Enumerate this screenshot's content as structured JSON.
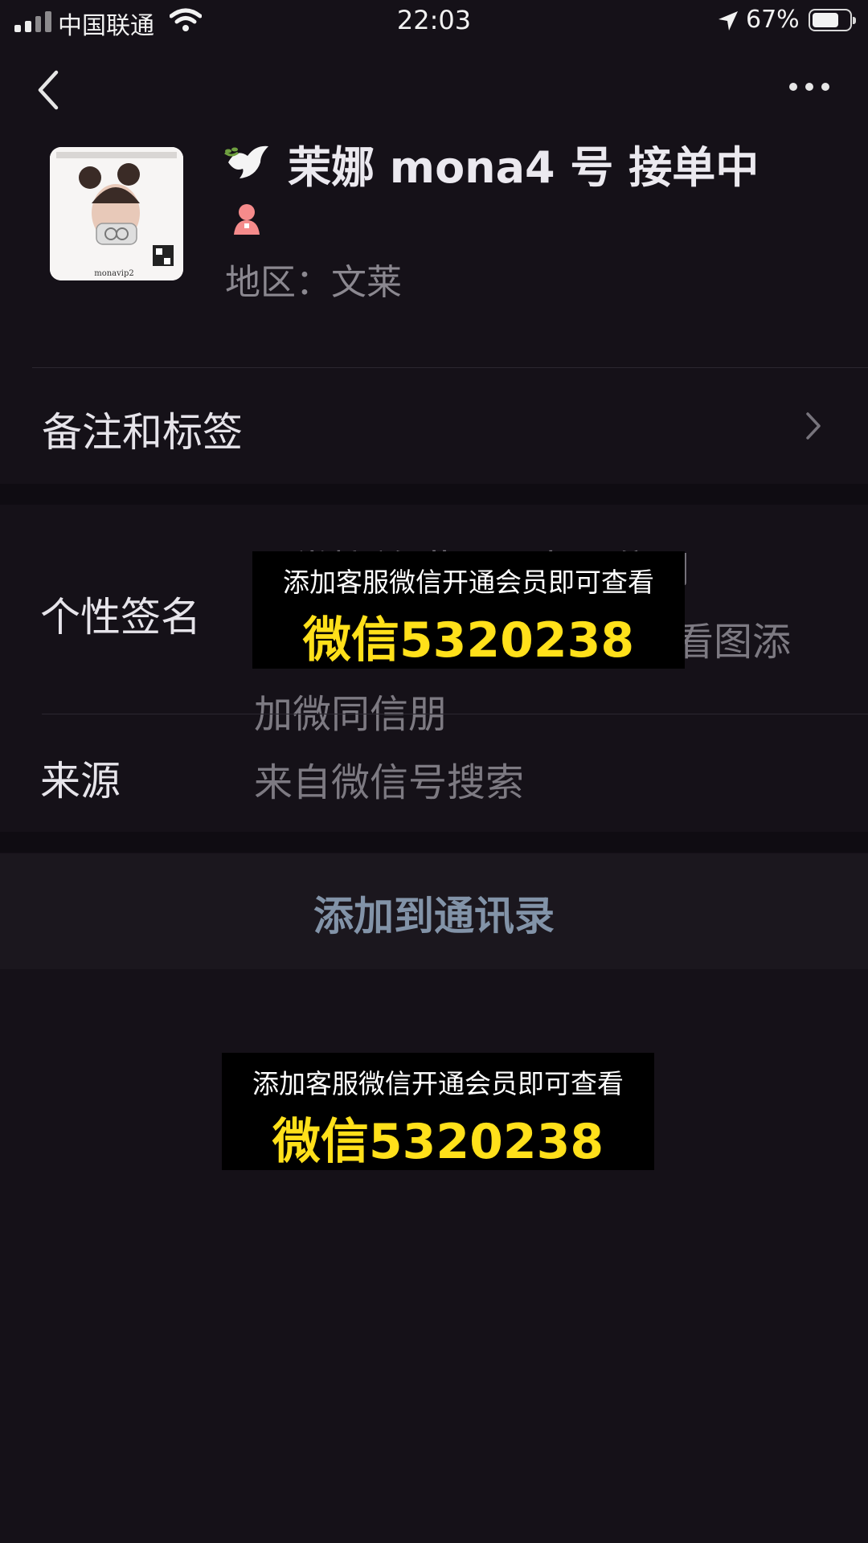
{
  "status_bar": {
    "carrier": "中国联通",
    "time": "22:03",
    "battery_percent": "67%",
    "battery_level": 0.67
  },
  "nav": {
    "back_icon": "chevron-left-icon",
    "more_icon": "more-dots-icon"
  },
  "profile": {
    "avatar_caption": "monavip2",
    "name_emoji": "dove-icon",
    "name": "茉娜  mona4 号 接单中",
    "gender_icon": "female-icon",
    "region": "地区：文莱"
  },
  "rows": {
    "remark_label": "备注和标签",
    "signature_label": "个性签名",
    "signature_value_line1": "工常接单 此号朋友圈信用",
    "signature_value_line2": "看图添",
    "signature_value_line3": "加微同信朋",
    "source_label": "来源",
    "source_value": "来自微信号搜索"
  },
  "banners": [
    {
      "line1": "添加客服微信开通会员即可查看",
      "line2": "微信5320238"
    },
    {
      "line1": "添加客服微信开通会员即可查看",
      "line2": "微信5320238"
    }
  ],
  "actions": {
    "add_contact": "添加到通讯录"
  },
  "colors": {
    "background": "#151118",
    "banner_bg": "#000000",
    "banner_accent": "#ffe01a",
    "link_blue": "#8293a8"
  }
}
